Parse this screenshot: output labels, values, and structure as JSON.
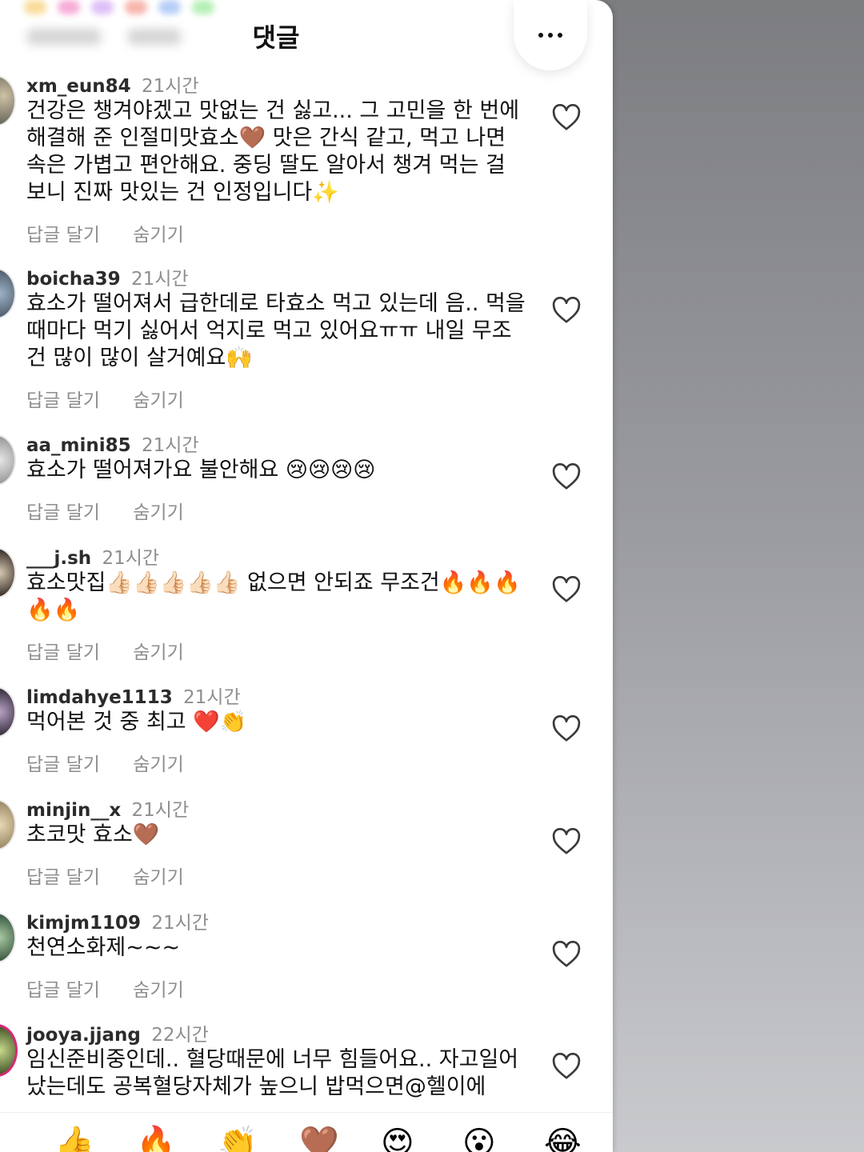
{
  "header": {
    "title": "댓글"
  },
  "actions": {
    "reply": "답글 달기",
    "hide": "숨기기"
  },
  "comments": [
    {
      "username": "xm_eun84",
      "time": "21시간",
      "text": "건강은 챙겨야겠고 맛없는 건 싫고... 그 고민을 한 번에 해결해 준 인절미맛효소🤎 맛은 간식 같고, 먹고 나면 속은 가볍고 편안해요. 중딩 딸도 알아서 챙겨 먹는 걸 보니 진짜 맛있는 건 인정입니다✨"
    },
    {
      "username": "boicha39",
      "time": "21시간",
      "text": "효소가 떨어져서 급한데로 타효소 먹고 있는데 음.. 먹을때마다 먹기 싫어서 억지로 먹고 있어요ㅠㅠ 내일 무조건 많이 많이 살거예요🙌"
    },
    {
      "username": "aa_mini85",
      "time": "21시간",
      "text": "효소가 떨어져가요 불안해요 😢😢😢😢"
    },
    {
      "username": "___j.sh",
      "time": "21시간",
      "text": "효소맛집👍🏻👍🏻👍🏻👍🏻👍🏻 없으면 안되죠 무조건🔥🔥🔥🔥🔥"
    },
    {
      "username": "limdahye1113",
      "time": "21시간",
      "text": "먹어본 것 중 최고 ❤️👏"
    },
    {
      "username": "minjin__x",
      "time": "21시간",
      "text": "초코맛 효소🤎"
    },
    {
      "username": "kimjm1109",
      "time": "21시간",
      "text": "천연소화제~~~"
    },
    {
      "username": "jooya.jjang",
      "time": "22시간",
      "text": "임신준비중인데.. 혈당때문에 너무 힘들어요.. 자고일어났는데도 공복혈당자체가 높으니 밥먹으면@헬이에"
    }
  ],
  "reactions": [
    "👍",
    "🔥",
    "👏",
    "🤎",
    "😍",
    "😮",
    "😂"
  ],
  "colors": {
    "accent_ring": "#d62976",
    "muted_text": "#8e8e8e"
  }
}
